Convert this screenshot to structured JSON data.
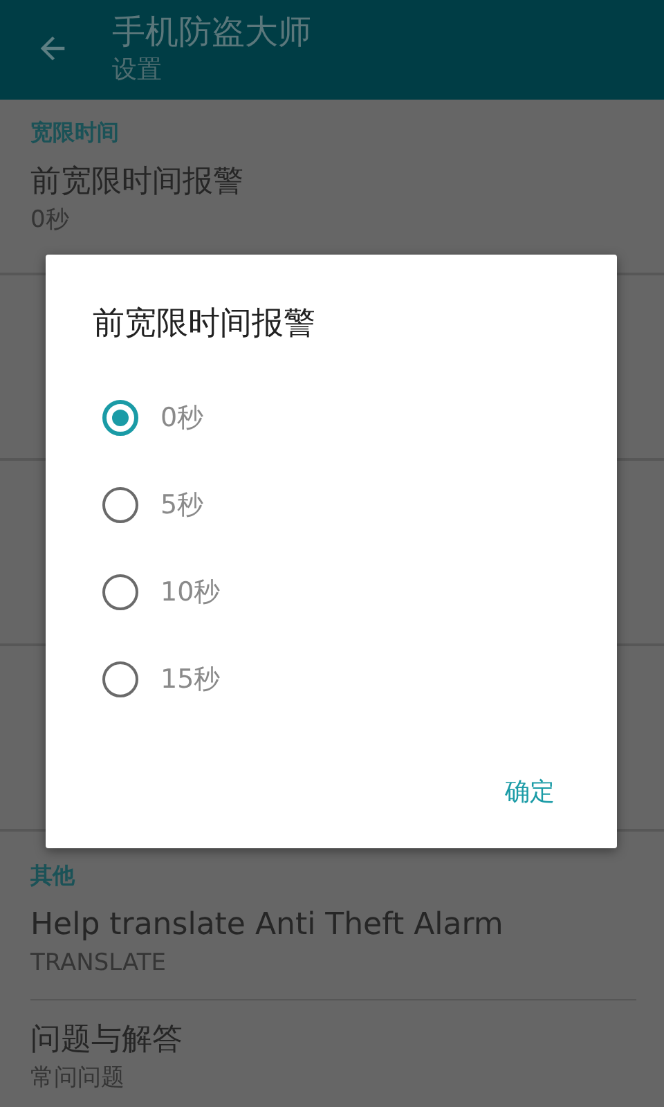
{
  "app_bar": {
    "title": "手机防盗大师",
    "subtitle": "设置"
  },
  "sections": [
    {
      "kind": "shown",
      "header": "宽限时间",
      "items": [
        {
          "title": "前宽限时间报警",
          "summary": "0秒"
        }
      ]
    },
    {
      "kind": "covered"
    },
    {
      "kind": "covered"
    },
    {
      "kind": "covered"
    },
    {
      "kind": "shown",
      "header": "其他",
      "items": [
        {
          "title": "Help translate Anti Theft Alarm",
          "summary": "TRANSLATE"
        },
        {
          "title": "问题与解答",
          "summary": "常问问题"
        }
      ]
    }
  ],
  "dialog": {
    "title": "前宽限时间报警",
    "options": [
      {
        "label": "0秒",
        "selected": true
      },
      {
        "label": "5秒",
        "selected": false
      },
      {
        "label": "10秒",
        "selected": false
      },
      {
        "label": "15秒",
        "selected": false
      }
    ],
    "buttons": [
      "确定"
    ]
  }
}
